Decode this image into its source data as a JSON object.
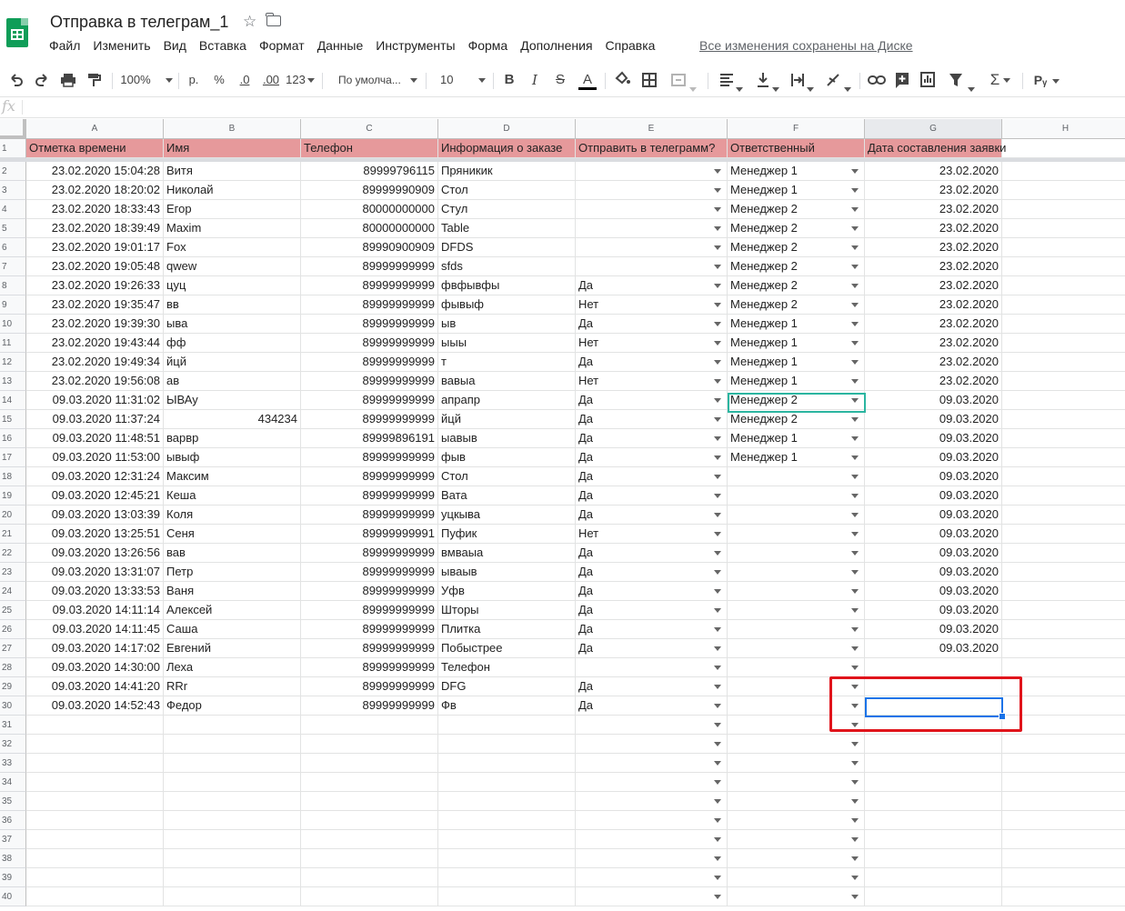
{
  "doc": {
    "title": "Отправка в телеграм_1",
    "saved_status": "Все изменения сохранены на Диске"
  },
  "menu": [
    "Файл",
    "Изменить",
    "Вид",
    "Вставка",
    "Формат",
    "Данные",
    "Инструменты",
    "Форма",
    "Дополнения",
    "Справка"
  ],
  "toolbar": {
    "zoom": "100%",
    "currency": "р.",
    "percent": "%",
    "dec_less": ".0",
    "dec_more": ".00",
    "more_formats": "123",
    "font": "По умолча...",
    "font_size": "10",
    "bold": "B",
    "italic": "I",
    "strike": "S",
    "text_color": "A",
    "script": "Рᵧ"
  },
  "formula_bar": {
    "label": "fx",
    "value": ""
  },
  "columns": [
    "A",
    "B",
    "C",
    "D",
    "E",
    "F",
    "G",
    "H"
  ],
  "header_row": [
    "Отметка времени",
    "Имя",
    "Телефон",
    "Информация о заказе",
    "Отправить в телеграмм?",
    "Ответственный",
    "Дата составления заявки"
  ],
  "rows": [
    [
      "23.02.2020 15:04:28",
      "Витя",
      "89999796115",
      "Пряникик",
      "",
      "Менеджер 1",
      "23.02.2020"
    ],
    [
      "23.02.2020 18:20:02",
      "Николай",
      "89999990909",
      "Стол",
      "",
      "Менеджер 1",
      "23.02.2020"
    ],
    [
      "23.02.2020 18:33:43",
      "Егор",
      "80000000000",
      "Стул",
      "",
      "Менеджер 2",
      "23.02.2020"
    ],
    [
      "23.02.2020 18:39:49",
      "Maxim",
      "80000000000",
      "Table",
      "",
      "Менеджер 2",
      "23.02.2020"
    ],
    [
      "23.02.2020 19:01:17",
      "Fox",
      "89990900909",
      "DFDS",
      "",
      "Менеджер 2",
      "23.02.2020"
    ],
    [
      "23.02.2020 19:05:48",
      "qwew",
      "89999999999",
      "sfds",
      "",
      "Менеджер 2",
      "23.02.2020"
    ],
    [
      "23.02.2020 19:26:33",
      "цуц",
      "89999999999",
      "фвфывфы",
      "Да",
      "Менеджер 2",
      "23.02.2020"
    ],
    [
      "23.02.2020 19:35:47",
      "вв",
      "89999999999",
      "фывыф",
      "Нет",
      "Менеджер 2",
      "23.02.2020"
    ],
    [
      "23.02.2020 19:39:30",
      "ыва",
      "89999999999",
      "ыв",
      "Да",
      "Менеджер 1",
      "23.02.2020"
    ],
    [
      "23.02.2020 19:43:44",
      "фф",
      "89999999999",
      "ыыы",
      "Нет",
      "Менеджер 1",
      "23.02.2020"
    ],
    [
      "23.02.2020 19:49:34",
      "йцй",
      "89999999999",
      "т",
      "Да",
      "Менеджер 1",
      "23.02.2020"
    ],
    [
      "23.02.2020 19:56:08",
      "ав",
      "89999999999",
      "вавыа",
      "Нет",
      "Менеджер 1",
      "23.02.2020"
    ],
    [
      "09.03.2020 11:31:02",
      "ЫВАу",
      "89999999999",
      "апрапр",
      "Да",
      "Менеджер 2",
      "09.03.2020"
    ],
    [
      "09.03.2020 11:37:24",
      "434234",
      "89999999999",
      "йцй",
      "Да",
      "Менеджер 2",
      "09.03.2020"
    ],
    [
      "09.03.2020 11:48:51",
      "варвр",
      "89999896191",
      "ыавыв",
      "Да",
      "Менеджер 1",
      "09.03.2020"
    ],
    [
      "09.03.2020 11:53:00",
      "ывыф",
      "89999999999",
      "фыв",
      "Да",
      "Менеджер 1",
      "09.03.2020"
    ],
    [
      "09.03.2020 12:31:24",
      "Максим",
      "89999999999",
      "Стол",
      "Да",
      "",
      "09.03.2020"
    ],
    [
      "09.03.2020 12:45:21",
      "Кеша",
      "89999999999",
      "Вата",
      "Да",
      "",
      "09.03.2020"
    ],
    [
      "09.03.2020 13:03:39",
      "Коля",
      "89999999999",
      "уцкыва",
      "Да",
      "",
      "09.03.2020"
    ],
    [
      "09.03.2020 13:25:51",
      "Сеня",
      "89999999991",
      "Пуфик",
      "Нет",
      "",
      "09.03.2020"
    ],
    [
      "09.03.2020 13:26:56",
      "вав",
      "89999999999",
      "вмваыа",
      "Да",
      "",
      "09.03.2020"
    ],
    [
      "09.03.2020 13:31:07",
      "Петр",
      "89999999999",
      "ываыв",
      "Да",
      "",
      "09.03.2020"
    ],
    [
      "09.03.2020 13:33:53",
      "Ваня",
      "89999999999",
      "Уфв",
      "Да",
      "",
      "09.03.2020"
    ],
    [
      "09.03.2020 14:11:14",
      "Алексей",
      "89999999999",
      "Шторы",
      "Да",
      "",
      "09.03.2020"
    ],
    [
      "09.03.2020 14:11:45",
      "Саша",
      "89999999999",
      "Плитка",
      "Да",
      "",
      "09.03.2020"
    ],
    [
      "09.03.2020 14:17:02",
      "Евгений",
      "89999999999",
      "Побыстрее",
      "Да",
      "",
      "09.03.2020"
    ],
    [
      "09.03.2020 14:30:00",
      "Леха",
      "89999999999",
      "Телефон",
      "",
      "",
      ""
    ],
    [
      "09.03.2020 14:41:20",
      "RRr",
      "89999999999",
      "DFG",
      "Да",
      "",
      ""
    ],
    [
      "09.03.2020 14:52:43",
      "Федор",
      "89999999999",
      "Фв",
      "Да",
      "",
      ""
    ],
    [
      "",
      "",
      "",
      "",
      "",
      "",
      ""
    ],
    [
      "",
      "",
      "",
      "",
      "",
      "",
      ""
    ],
    [
      "",
      "",
      "",
      "",
      "",
      "",
      ""
    ],
    [
      "",
      "",
      "",
      "",
      "",
      "",
      ""
    ],
    [
      "",
      "",
      "",
      "",
      "",
      "",
      ""
    ],
    [
      "",
      "",
      "",
      "",
      "",
      "",
      ""
    ],
    [
      "",
      "",
      "",
      "",
      "",
      "",
      ""
    ],
    [
      "",
      "",
      "",
      "",
      "",
      "",
      ""
    ],
    [
      "",
      "",
      "",
      "",
      "",
      "",
      ""
    ],
    [
      "",
      "",
      "",
      "",
      "",
      "",
      ""
    ]
  ],
  "row_numbers": [
    "1",
    "2",
    "3",
    "4",
    "5",
    "6",
    "7",
    "8",
    "9",
    "10",
    "11",
    "12",
    "13",
    "14",
    "15",
    "16",
    "17",
    "18",
    "19",
    "20",
    "21",
    "22",
    "23",
    "24",
    "25",
    "26",
    "27",
    "28",
    "29",
    "30",
    "31",
    "32",
    "33",
    "34",
    "35",
    "36",
    "37",
    "38",
    "39",
    "40"
  ],
  "colors": {
    "header_fill": "#e6999b",
    "selection": "#1a73e8",
    "highlight_box": "#e0141b",
    "sheets_green": "#0f9d58"
  }
}
